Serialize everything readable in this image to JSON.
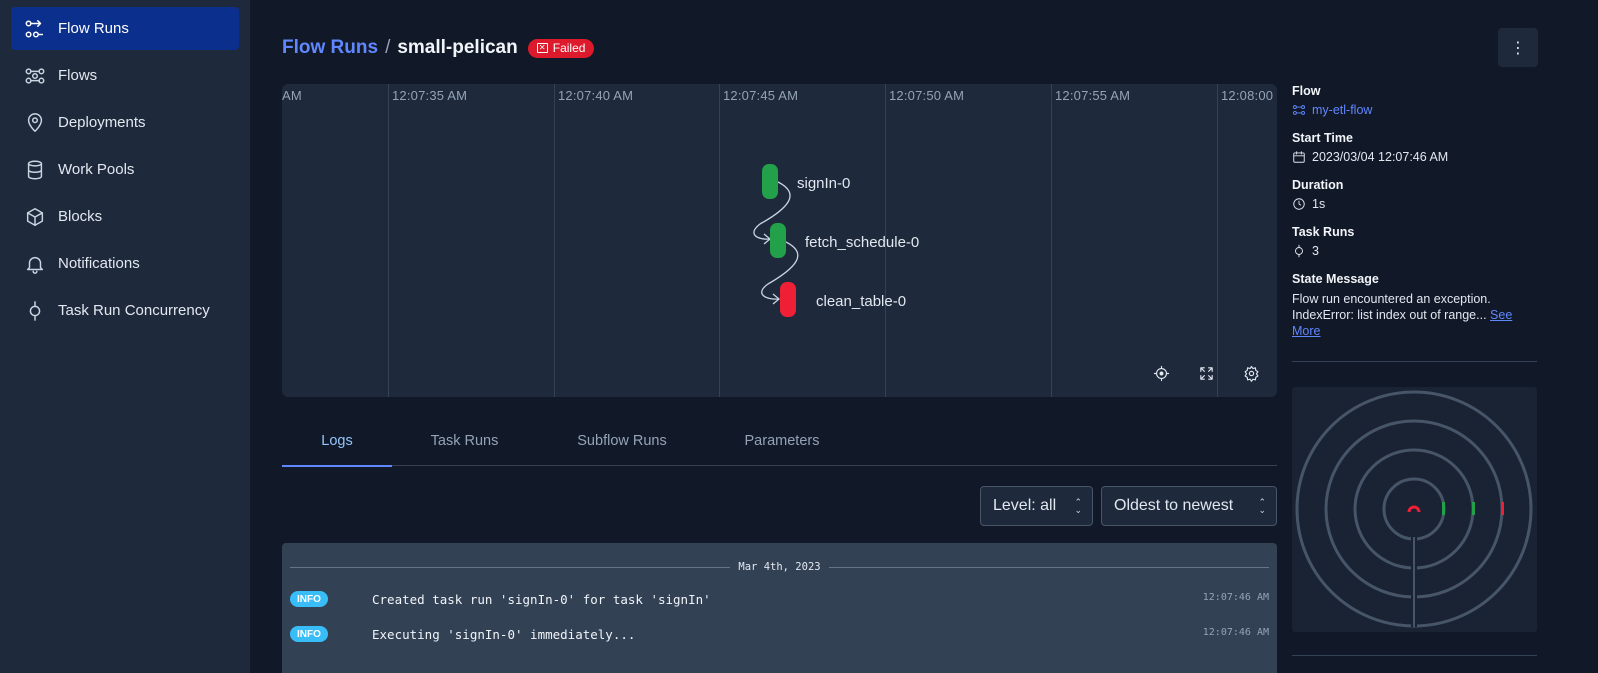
{
  "sidebar": {
    "items": [
      {
        "label": "Flow Runs",
        "icon": "flow-runs-icon",
        "active": true
      },
      {
        "label": "Flows",
        "icon": "flows-icon"
      },
      {
        "label": "Deployments",
        "icon": "location-pin-icon"
      },
      {
        "label": "Work Pools",
        "icon": "database-icon"
      },
      {
        "label": "Blocks",
        "icon": "cube-icon"
      },
      {
        "label": "Notifications",
        "icon": "bell-icon"
      },
      {
        "label": "Task Run Concurrency",
        "icon": "concurrency-icon"
      }
    ]
  },
  "header": {
    "breadcrumb_root": "Flow Runs",
    "separator": "/",
    "run_name": "small-pelican",
    "state_badge": "Failed",
    "menu_icon": "kebab-menu-icon"
  },
  "timeline": {
    "ticks": [
      "AM",
      "12:07:35 AM",
      "12:07:40 AM",
      "12:07:45 AM",
      "12:07:50 AM",
      "12:07:55 AM",
      "12:08:00"
    ],
    "nodes": [
      {
        "label": "signIn-0",
        "state": "completed"
      },
      {
        "label": "fetch_schedule-0",
        "state": "completed"
      },
      {
        "label": "clean_table-0",
        "state": "failed"
      }
    ],
    "controls": [
      "recenter-icon",
      "fullscreen-icon",
      "settings-gear-icon"
    ]
  },
  "tabs": [
    {
      "label": "Logs",
      "active": true
    },
    {
      "label": "Task Runs"
    },
    {
      "label": "Subflow Runs"
    },
    {
      "label": "Parameters"
    }
  ],
  "log_controls": {
    "level": "Level: all",
    "sort": "Oldest to newest"
  },
  "logs": {
    "date": "Mar 4th, 2023",
    "rows": [
      {
        "level": "INFO",
        "message": "Created task run 'signIn-0' for task 'signIn'",
        "time": "12:07:46 AM"
      },
      {
        "level": "INFO",
        "message": "Executing 'signIn-0' immediately...",
        "time": "12:07:46 AM"
      }
    ]
  },
  "details": {
    "flow_label": "Flow",
    "flow_value": "my-etl-flow",
    "start_label": "Start Time",
    "start_value": "2023/03/04 12:07:46 AM",
    "duration_label": "Duration",
    "duration_value": "1s",
    "task_runs_label": "Task Runs",
    "task_runs_value": "3",
    "state_message_label": "State Message",
    "state_message_line1": "Flow run encountered an exception.",
    "state_message_line2": "IndexError: list index out of range...",
    "see_more": "See More"
  },
  "colors": {
    "accent": "#6187ff",
    "completed": "#22a04a",
    "failed": "#ef1f36",
    "info": "#38bdf8"
  }
}
